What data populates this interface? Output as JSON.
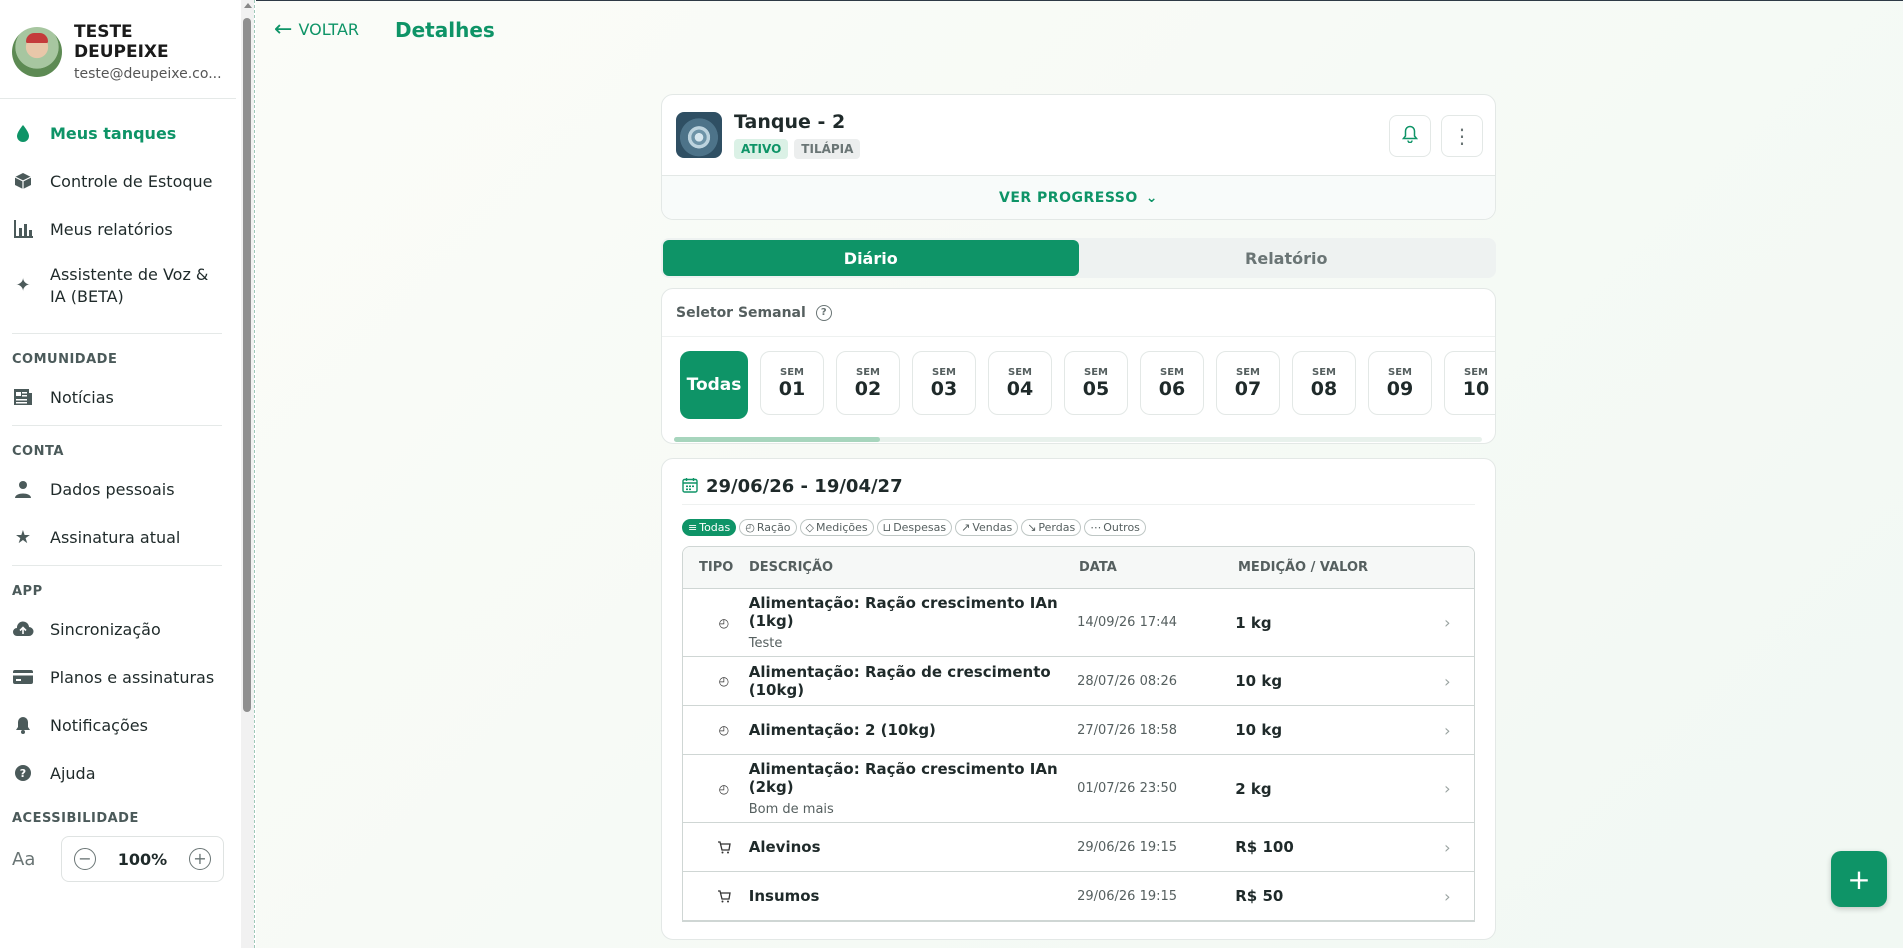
{
  "profile": {
    "name": "TESTE DEUPEIXE",
    "email": "teste@deupeixe.co..."
  },
  "nav_main": [
    {
      "label": "Meus tanques",
      "icon": "water-drop-icon",
      "active": true
    },
    {
      "label": "Controle de Estoque",
      "icon": "box-icon"
    },
    {
      "label": "Meus relatórios",
      "icon": "bar-chart-icon"
    },
    {
      "label": "Assistente de Voz & IA (BETA)",
      "icon": "sparkles-icon"
    }
  ],
  "sections": {
    "community": "COMUNIDADE",
    "account": "CONTA",
    "app": "APP",
    "accessibility": "ACESSIBILIDADE"
  },
  "nav_community": [
    {
      "label": "Notícias",
      "icon": "newspaper-icon"
    }
  ],
  "nav_account": [
    {
      "label": "Dados pessoais",
      "icon": "person-icon"
    },
    {
      "label": "Assinatura atual",
      "icon": "star-icon"
    }
  ],
  "nav_app": [
    {
      "label": "Sincronização",
      "icon": "cloud-upload-icon"
    },
    {
      "label": "Planos e assinaturas",
      "icon": "credit-card-icon"
    },
    {
      "label": "Notificações",
      "icon": "bell-icon"
    },
    {
      "label": "Ajuda",
      "icon": "help-icon"
    }
  ],
  "accessibility": {
    "aa": "Aa",
    "zoom": "100%"
  },
  "topbar": {
    "back": "VOLTAR",
    "title": "Detalhes"
  },
  "tank": {
    "name": "Tanque - 2",
    "status": "ATIVO",
    "species": "TILÁPIA",
    "progress": "VER PROGRESSO"
  },
  "tabs": [
    "Diário",
    "Relatório"
  ],
  "week_selector": {
    "title": "Seletor Semanal",
    "help": "?",
    "all": "Todas",
    "prefix": "SEM",
    "weeks": [
      "01",
      "02",
      "03",
      "04",
      "05",
      "06",
      "07",
      "08",
      "09",
      "10"
    ]
  },
  "list": {
    "date_range": "29/06/26 - 19/04/27",
    "filters": [
      "Todas",
      "Ração",
      "Medições",
      "Despesas",
      "Vendas",
      "Perdas",
      "Outros"
    ],
    "headers": {
      "tipo": "TIPO",
      "desc": "DESCRIÇÃO",
      "data": "DATA",
      "valor": "MEDIÇÃO / VALOR"
    },
    "rows": [
      {
        "icon": "feed-icon",
        "desc": "Alimentação: Ração crescimento IAn (1kg)",
        "sub": "Teste",
        "date": "14/09/26 17:44",
        "value": "1 kg"
      },
      {
        "icon": "feed-icon",
        "desc": "Alimentação: Ração de crescimento (10kg)",
        "sub": "",
        "date": "28/07/26 08:26",
        "value": "10 kg"
      },
      {
        "icon": "feed-icon",
        "desc": "Alimentação: 2 (10kg)",
        "sub": "",
        "date": "27/07/26 18:58",
        "value": "10 kg"
      },
      {
        "icon": "feed-icon",
        "desc": "Alimentação: Ração crescimento IAn (2kg)",
        "sub": "Bom de mais",
        "date": "01/07/26 23:50",
        "value": "2 kg"
      },
      {
        "icon": "cart-icon",
        "desc": "Alevinos",
        "sub": "",
        "date": "29/06/26 19:15",
        "value": "R$ 100"
      },
      {
        "icon": "cart-icon",
        "desc": "Insumos",
        "sub": "",
        "date": "29/06/26 19:15",
        "value": "R$ 50"
      }
    ]
  },
  "fab": "+"
}
